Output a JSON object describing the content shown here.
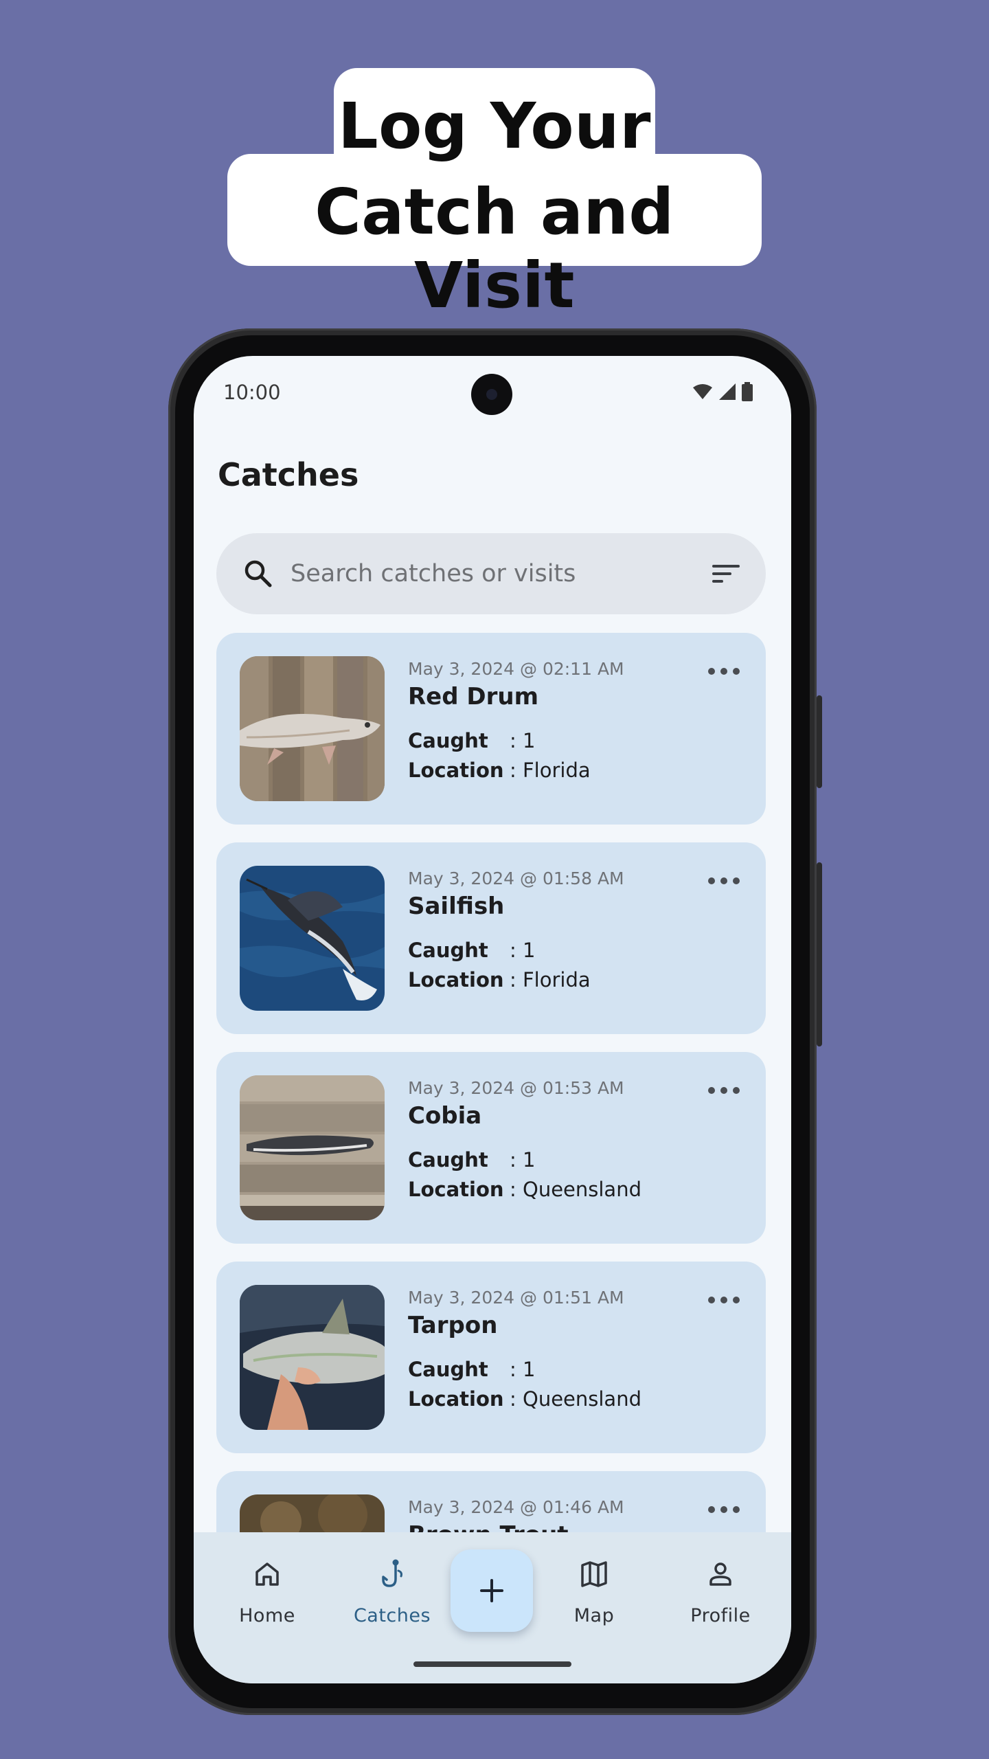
{
  "headline": {
    "line1": "Log Your",
    "line2": "Catch and Visit"
  },
  "colors": {
    "background": "#6a6fa6",
    "card": "#d3e3f2",
    "accent": "#2c5f86",
    "fab": "#cbe5fb"
  },
  "status_bar": {
    "time": "10:00",
    "icons": [
      "wifi-icon",
      "signal-icon",
      "battery-icon"
    ]
  },
  "page": {
    "title": "Catches"
  },
  "search": {
    "placeholder": "Search catches or visits",
    "icon": "search-icon",
    "filter_icon": "filter-icon"
  },
  "catches": [
    {
      "date": "May 3, 2024 @ 02:11 AM",
      "name": "Red Drum",
      "caught_label": "Caught",
      "caught": ": 1",
      "location_label": "Location",
      "location": ": Florida"
    },
    {
      "date": "May 3, 2024 @ 01:58 AM",
      "name": "Sailfish",
      "caught_label": "Caught",
      "caught": ": 1",
      "location_label": "Location",
      "location": ": Florida"
    },
    {
      "date": "May 3, 2024 @ 01:53 AM",
      "name": "Cobia",
      "caught_label": "Caught",
      "caught": ": 1",
      "location_label": "Location",
      "location": ": Queensland"
    },
    {
      "date": "May 3, 2024 @ 01:51 AM",
      "name": "Tarpon",
      "caught_label": "Caught",
      "caught": ": 1",
      "location_label": "Location",
      "location": ": Queensland"
    },
    {
      "date": "May 3, 2024 @ 01:46 AM",
      "name": "Brown Trout"
    }
  ],
  "bottom_nav": {
    "items": [
      {
        "label": "Home",
        "icon": "home-icon"
      },
      {
        "label": "Catches",
        "icon": "fish-hook-icon",
        "active": true
      },
      {
        "label": "Map",
        "icon": "map-icon"
      },
      {
        "label": "Profile",
        "icon": "person-icon"
      }
    ],
    "fab_icon": "plus-icon"
  }
}
